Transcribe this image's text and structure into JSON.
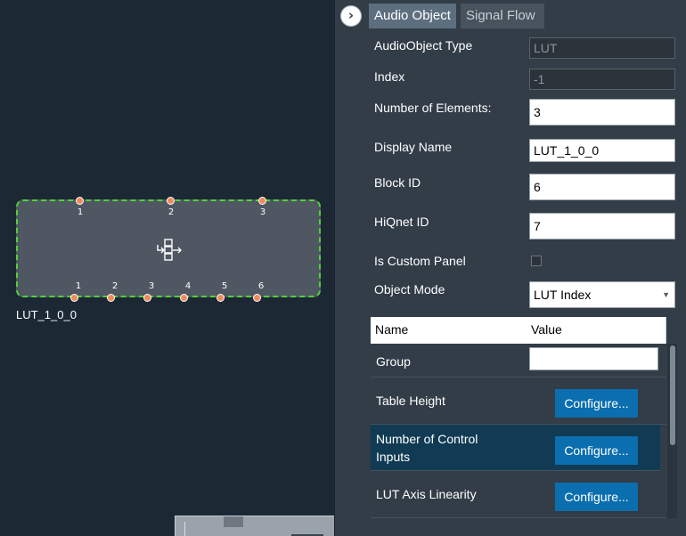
{
  "canvas": {
    "block": {
      "name": "LUT_1_0_0",
      "top_pins": [
        "1",
        "2",
        "3"
      ],
      "bottom_pins": [
        "1",
        "2",
        "3",
        "4",
        "5",
        "6"
      ],
      "icon": "lut-block-icon",
      "border_color": "#52d138",
      "pin_color": "#f08a5d"
    }
  },
  "panel": {
    "collapse_icon": "chevron-right-icon",
    "collapse_symbol": "›",
    "tabs": [
      {
        "label": "Audio Object",
        "active": true
      },
      {
        "label": "Signal Flow",
        "active": false
      }
    ],
    "properties": {
      "audioobject_type": {
        "label": "AudioObject Type",
        "value": "LUT"
      },
      "index": {
        "label": "Index",
        "value": "-1"
      },
      "num_elements": {
        "label": "Number of Elements:",
        "value": "3"
      },
      "display_name": {
        "label": "Display Name",
        "value": "LUT_1_0_0"
      },
      "block_id": {
        "label": "Block ID",
        "value": "6"
      },
      "hiqnet_id": {
        "label": "HiQnet ID",
        "value": "7"
      },
      "is_custom_panel": {
        "label": "Is Custom Panel",
        "checked": false
      },
      "object_mode": {
        "label": "Object Mode",
        "value": "LUT Index"
      }
    },
    "grid": {
      "columns": [
        "Name",
        "Value"
      ],
      "rows": [
        {
          "name": "Group",
          "value": ""
        },
        {
          "name": "Table Height",
          "button": "Configure..."
        },
        {
          "name": "Number of Control Inputs",
          "button": "Configure..."
        },
        {
          "name": "LUT Axis Linearity",
          "button": "Configure..."
        }
      ]
    },
    "accent_color": "#0b6eae",
    "selected_row_color": "#113b54"
  }
}
